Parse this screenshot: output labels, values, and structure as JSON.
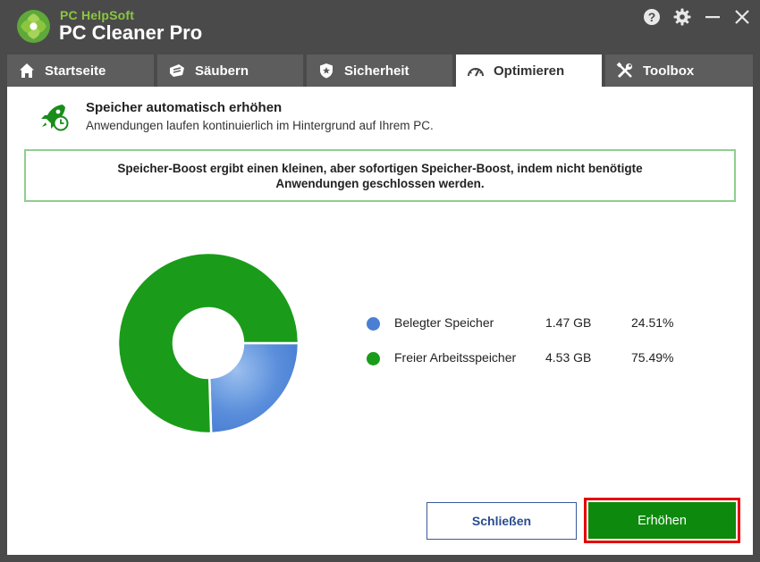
{
  "app": {
    "brand_small": "PC HelpSoft",
    "brand_large": "PC Cleaner Pro"
  },
  "titlebar_buttons": [
    "help-icon",
    "gear-icon",
    "minimize-icon",
    "close-icon"
  ],
  "tabs": [
    {
      "label": "Startseite",
      "icon": "home-icon",
      "active": false
    },
    {
      "label": "Säubern",
      "icon": "broom-icon",
      "active": false
    },
    {
      "label": "Sicherheit",
      "icon": "shield-icon",
      "active": false
    },
    {
      "label": "Optimieren",
      "icon": "speedometer-icon",
      "active": true
    },
    {
      "label": "Toolbox",
      "icon": "tools-icon",
      "active": false
    }
  ],
  "header": {
    "title": "Speicher automatisch erhöhen",
    "subtitle": "Anwendungen laufen kontinuierlich im Hintergrund auf Ihrem PC."
  },
  "info_text": "Speicher-Boost ergibt einen kleinen, aber sofortigen Speicher-Boost, indem nicht benötigte Anwendungen geschlossen werden.",
  "chart_data": {
    "type": "pie",
    "series": [
      {
        "name": "Belegter Speicher",
        "size": "1.47 GB",
        "percent_label": "24.51%",
        "value": 24.51,
        "color": "#4a7fd4"
      },
      {
        "name": "Freier Arbeitsspeicher",
        "size": "4.53 GB",
        "percent_label": "75.49%",
        "value": 75.49,
        "color": "#1a9c1a"
      }
    ]
  },
  "buttons": {
    "close_label": "Schließen",
    "boost_label": "Erhöhen"
  },
  "colors": {
    "accent_green": "#0d8a0d",
    "highlight_red": "#e60000",
    "tab_bg": "#5d5d5d",
    "window_bg": "#4a4a4a"
  }
}
